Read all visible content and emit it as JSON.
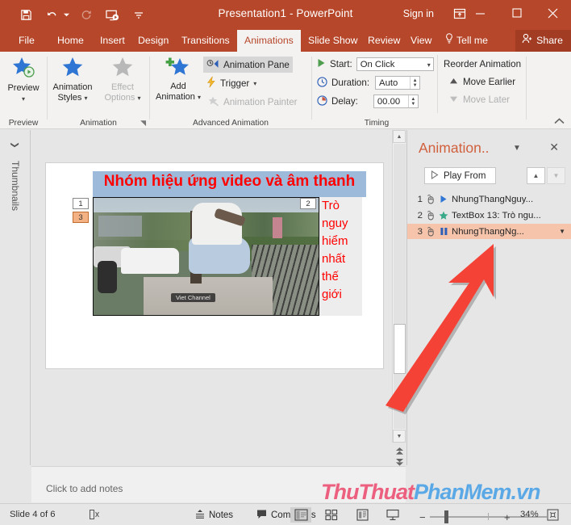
{
  "titlebar": {
    "app_title": "Presentation1  -  PowerPoint",
    "sign_in": "Sign in",
    "qat": [
      {
        "name": "save-icon",
        "label": "Save"
      },
      {
        "name": "undo-icon",
        "label": "Undo"
      },
      {
        "name": "redo-icon",
        "label": "Redo"
      },
      {
        "name": "start-from-beginning-icon",
        "label": "Start From Beginning"
      },
      {
        "name": "customize-qat-icon",
        "label": "Customize Quick Access Toolbar"
      }
    ],
    "ribbon_display_options": "Ribbon Display Options",
    "minimize": "Minimize",
    "restore": "Restore Down",
    "close": "Close"
  },
  "tabs": [
    {
      "label": "File",
      "active": false
    },
    {
      "label": "Home",
      "active": false
    },
    {
      "label": "Insert",
      "active": false
    },
    {
      "label": "Design",
      "active": false
    },
    {
      "label": "Transitions",
      "active": false
    },
    {
      "label": "Animations",
      "active": true
    },
    {
      "label": "Slide Show",
      "active": false
    },
    {
      "label": "Review",
      "active": false
    },
    {
      "label": "View",
      "active": false
    }
  ],
  "tell_me": "Tell me",
  "share": "Share",
  "ribbon": {
    "groups": [
      {
        "label": "Preview"
      },
      {
        "label": "Animation"
      },
      {
        "label": "Advanced Animation"
      },
      {
        "label": "Timing"
      }
    ],
    "preview_button": "Preview",
    "animation_styles": "Animation\nStyles",
    "animation_styles_l1": "Animation",
    "animation_styles_l2": "Styles",
    "effect_options_l1": "Effect",
    "effect_options_l2": "Options",
    "add_animation_l1": "Add",
    "add_animation_l2": "Animation",
    "animation_pane": "Animation Pane",
    "trigger": "Trigger",
    "animation_painter": "Animation Painter",
    "start_label": "Start:",
    "start_value": "On Click",
    "duration_label": "Duration:",
    "duration_value": "Auto",
    "delay_label": "Delay:",
    "delay_value": "00.00",
    "reorder_animation": "Reorder Animation",
    "move_earlier": "Move Earlier",
    "move_later": "Move Later",
    "collapse_ribbon": "Collapse the Ribbon"
  },
  "thumbnails": {
    "label": "Thumbnails"
  },
  "slide": {
    "title_text": "Nhóm hiệu ứng video và âm thanh",
    "side_text_lines": [
      "Trò",
      "nguy",
      "hiểm",
      "nhất",
      "thế",
      "giới"
    ],
    "video_watermark": "Viet Channel",
    "animation_tags": [
      "1",
      "3",
      "2"
    ],
    "title_fill": "#9dbada",
    "title_color": "#ff0000",
    "side_text_color": "#ff0000"
  },
  "animation_pane": {
    "title": "Animation..",
    "play_from": "Play From",
    "close": "Close",
    "move_up": "Move Up",
    "move_down": "Move Down",
    "items": [
      {
        "num": "1",
        "type": "media-play",
        "label": "NhungThangNguy...",
        "selected": false,
        "color": "#2e75d4"
      },
      {
        "num": "2",
        "type": "emphasis-star",
        "label": "TextBox 13: Trò ngu...",
        "selected": false,
        "color": "#3aa98a"
      },
      {
        "num": "3",
        "type": "media-pause",
        "label": "NhungThangNg...",
        "selected": true,
        "color": "#2e5fb8"
      }
    ],
    "selected_fill": "#f6c4ab"
  },
  "notes": {
    "placeholder": "Click to add notes"
  },
  "watermark": {
    "part1": "ThuThuat",
    "part2": "PhanMem.vn",
    "color1": "#ec5f7e",
    "color2": "#5aa9e6"
  },
  "statusbar": {
    "slide_info": "Slide 4 of 6",
    "language_icon": "spell-check-icon",
    "notes": "Notes",
    "comments": "Comments",
    "views": [
      {
        "name": "normal-view",
        "active": true
      },
      {
        "name": "slide-sorter-view",
        "active": false
      },
      {
        "name": "reading-view",
        "active": false
      },
      {
        "name": "slide-show-view",
        "active": false
      }
    ],
    "zoom_out": "−",
    "zoom_in": "+",
    "zoom_level": "34%",
    "fit_to_window": "Fit slide to current window"
  }
}
